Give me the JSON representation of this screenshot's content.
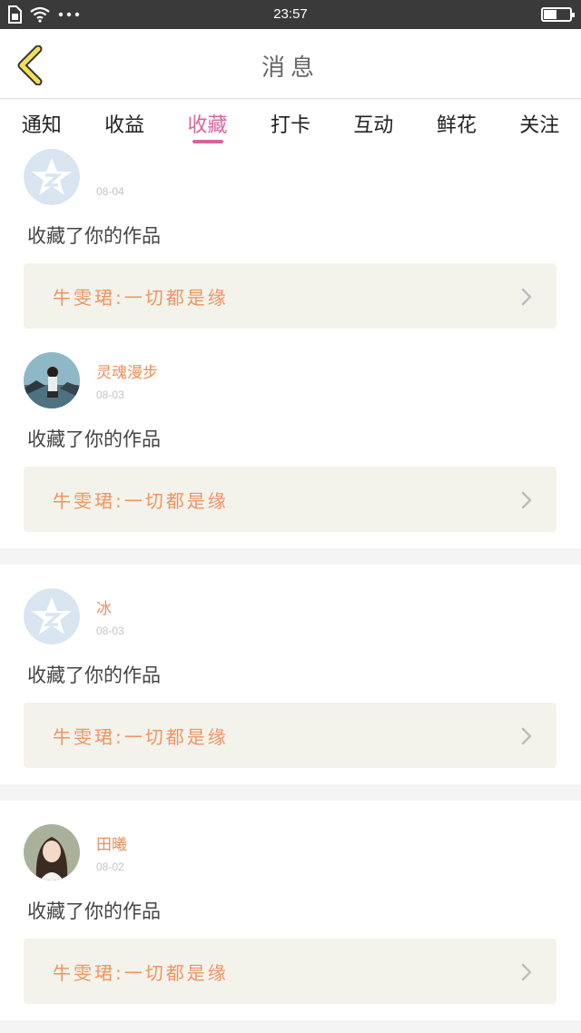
{
  "status_bar": {
    "time": "23:57",
    "battery_level": 0.5
  },
  "header": {
    "title": "消息",
    "back_icon": "chevron-left-icon"
  },
  "tabs": [
    {
      "label": "通知"
    },
    {
      "label": "收益"
    },
    {
      "label": "收藏",
      "active": true
    },
    {
      "label": "打卡"
    },
    {
      "label": "互动"
    },
    {
      "label": "鲜花"
    },
    {
      "label": "关注"
    }
  ],
  "colors": {
    "accent": "#d9649c",
    "name": "#e8905a",
    "work_title": "#ee9562",
    "work_bg": "#f3f3ec"
  },
  "messages": [
    {
      "name": "",
      "date": "08-04",
      "text": "收藏了你的作品",
      "work": "牛雯珺:一切都是缘"
    },
    {
      "name": "灵魂漫步",
      "date": "08-03",
      "text": "收藏了你的作品",
      "work": "牛雯珺:一切都是缘"
    },
    {
      "name": "冰",
      "date": "08-03",
      "text": "收藏了你的作品",
      "work": "牛雯珺:一切都是缘"
    },
    {
      "name": "田曦",
      "date": "08-02",
      "text": "收藏了你的作品",
      "work": "牛雯珺:一切都是缘"
    }
  ]
}
